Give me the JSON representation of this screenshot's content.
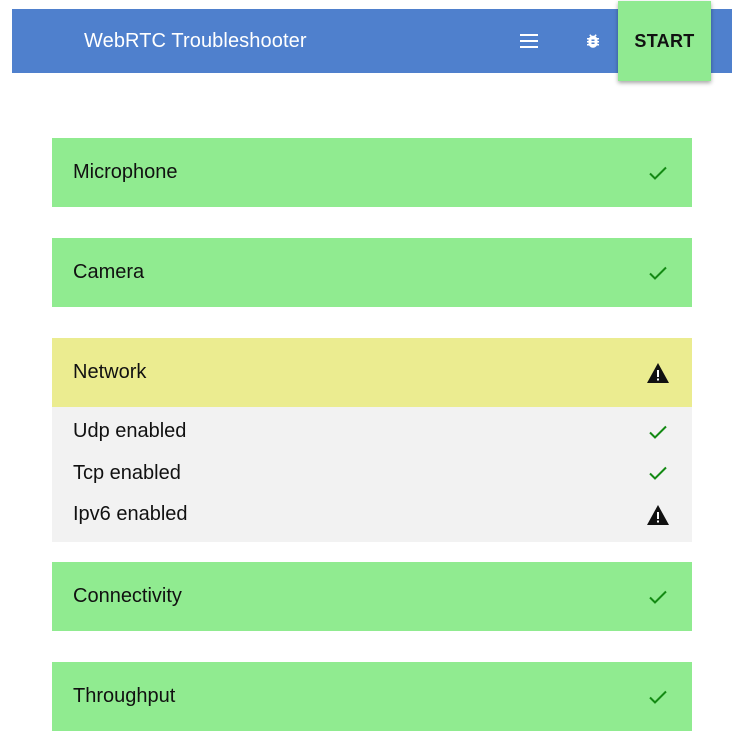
{
  "app": {
    "title": "WebRTC Troubleshooter",
    "start_label": "START",
    "menu_icon": "menu-icon",
    "bug_icon": "bug-report-icon"
  },
  "colors": {
    "toolbar": "#4f80cd",
    "pass": "#90eb90",
    "warn": "#ebec90",
    "details_bg": "#f2f2f2",
    "check": "#138a13"
  },
  "suites": [
    {
      "label": "Microphone",
      "status": "pass",
      "icon": "check-icon"
    },
    {
      "label": "Camera",
      "status": "pass",
      "icon": "check-icon"
    },
    {
      "label": "Network",
      "status": "warn",
      "icon": "warning-icon",
      "tests": [
        {
          "label": "Udp enabled",
          "status": "pass",
          "icon": "check-icon"
        },
        {
          "label": "Tcp enabled",
          "status": "pass",
          "icon": "check-icon"
        },
        {
          "label": "Ipv6 enabled",
          "status": "warn",
          "icon": "warning-icon"
        }
      ]
    },
    {
      "label": "Connectivity",
      "status": "pass",
      "icon": "check-icon"
    },
    {
      "label": "Throughput",
      "status": "pass",
      "icon": "check-icon"
    }
  ]
}
